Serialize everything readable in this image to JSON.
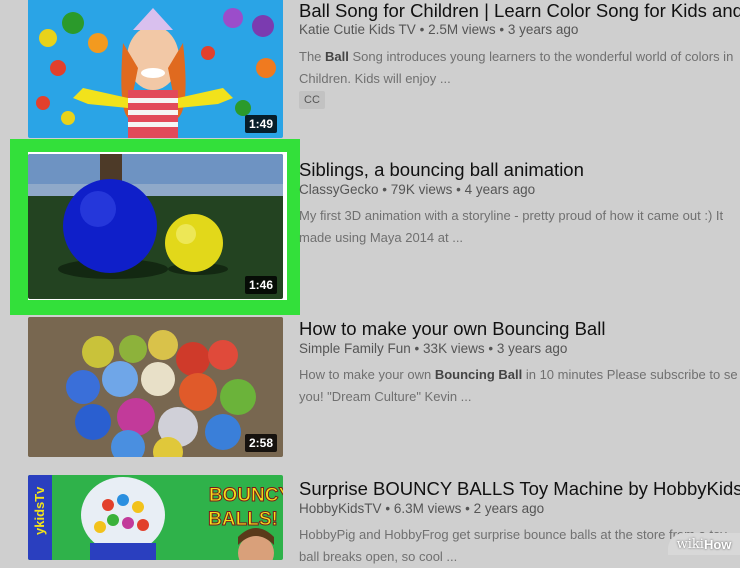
{
  "videos": [
    {
      "title": "Ball Song for Children | Learn Color Song for Kids and",
      "channel": "Katie Cutie Kids TV",
      "views": "2.5M views",
      "age": "3 years ago",
      "desc_pre": "The ",
      "desc_bold": "Ball",
      "desc_post": " Song introduces young learners to the wonderful world of colors in",
      "desc_line2": "Children. Kids will enjoy ...",
      "badge": "CC",
      "duration": "1:49"
    },
    {
      "title": "Siblings, a bouncing ball animation",
      "channel": "ClassyGecko",
      "views": "79K views",
      "age": "4 years ago",
      "desc_line1": "My first 3D animation with a storyline - pretty proud of how it came out :) It",
      "desc_line2": "made using Maya 2014 at ...",
      "duration": "1:46"
    },
    {
      "title": "How to make your own Bouncing Ball",
      "channel": "Simple Family Fun",
      "views": "33K views",
      "age": "3 years ago",
      "desc_pre": "How to make your own ",
      "desc_bold": "Bouncing Ball",
      "desc_post": " in 10 minutes Please subscribe to se",
      "desc_line2": "you! \"Dream Culture\" Kevin ...",
      "duration": "2:58"
    },
    {
      "title": "Surprise BOUNCY BALLS Toy Machine by HobbyKidsT",
      "channel": "HobbyKidsTV",
      "views": "6.3M views",
      "age": "2 years ago",
      "desc_line1": "HobbyPig and HobbyFrog get surprise bounce balls at the store from a toy",
      "desc_line2": "ball breaks open, so cool ...",
      "thumb_text_1": "BOUNCY",
      "thumb_text_2": "BALLS!",
      "thumb_brand": "ykidsTv"
    }
  ],
  "separator": "•",
  "watermark": {
    "wiki": "wiki",
    "how": "How"
  }
}
